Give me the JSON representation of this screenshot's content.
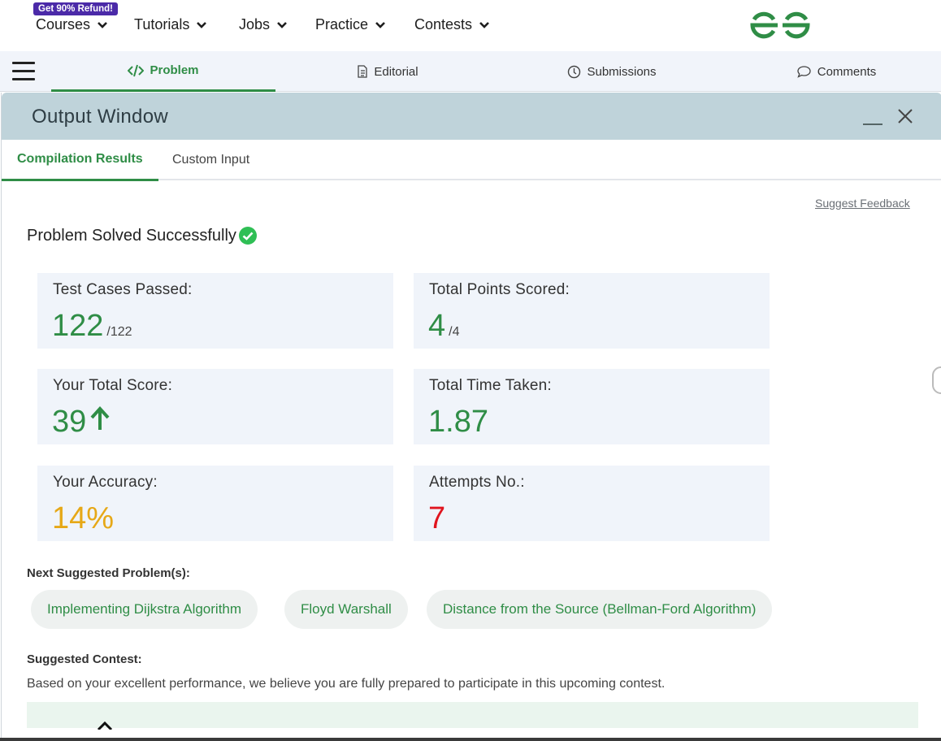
{
  "nav": {
    "promo": "Get 90% Refund!",
    "items": [
      "Courses",
      "Tutorials",
      "Jobs",
      "Practice",
      "Contests"
    ],
    "logo_icon": "gfg-logo-icon"
  },
  "problem_tabs": [
    {
      "label": "Problem",
      "icon": "code-icon",
      "active": true
    },
    {
      "label": "Editorial",
      "icon": "document-icon"
    },
    {
      "label": "Submissions",
      "icon": "clock-icon"
    },
    {
      "label": "Comments",
      "icon": "chat-bubble-icon"
    }
  ],
  "output_window": {
    "title": "Output Window",
    "tabs": [
      "Compilation Results",
      "Custom Input"
    ],
    "suggest_feedback": "Suggest Feedback",
    "status": "Problem Solved Successfully",
    "cards": {
      "test_cases": {
        "label": "Test Cases Passed:",
        "value": "122",
        "total": "/122"
      },
      "points": {
        "label": "Total Points Scored:",
        "value": "4",
        "total": "/4"
      },
      "score": {
        "label": "Your Total Score:",
        "value": "39"
      },
      "time": {
        "label": "Total Time Taken:",
        "value": "1.87"
      },
      "accuracy": {
        "label": "Your Accuracy:",
        "value": "14%"
      },
      "attempts": {
        "label": "Attempts No.:",
        "value": "7"
      }
    },
    "next_label": "Next Suggested Problem(s):",
    "suggestions": [
      "Implementing Dijkstra Algorithm",
      "Floyd Warshall",
      "Distance from the Source (Bellman-Ford Algorithm)"
    ],
    "contest_label": "Suggested Contest:",
    "contest_desc": "Based on your excellent performance, we believe you are fully prepared to participate in this upcoming contest."
  },
  "colors": {
    "accent_green": "#2f8d46",
    "accuracy_yellow": "#e6a817",
    "attempts_red": "#e0141e",
    "header_bg": "#bfd3da",
    "card_bg": "#f0f4fa"
  }
}
